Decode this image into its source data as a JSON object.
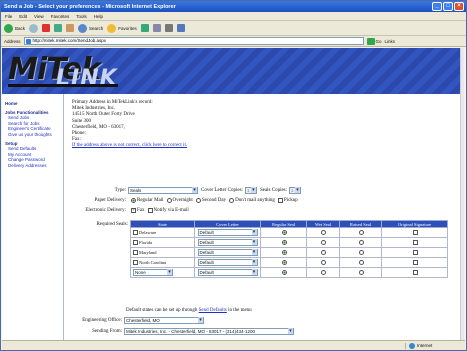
{
  "window": {
    "title": "Send a Job - Select your preferences - Microsoft Internet Explorer"
  },
  "menu": [
    "File",
    "Edit",
    "View",
    "Favorites",
    "Tools",
    "Help"
  ],
  "toolbar": {
    "back": "Back",
    "search": "Search",
    "favorites": "Favorites"
  },
  "address": {
    "label": "Address",
    "url": "http://mitek.mitek.com/SendJob.aspx",
    "go": "Go",
    "links": "Links"
  },
  "logo": {
    "part1": "MiTek",
    "part2": "LINK"
  },
  "sidebar": {
    "home": "Home",
    "job_section": "Jobs Functionalities",
    "job_links": [
      "Send Jobs",
      "Search for Jobs",
      "Engineer's Certificate",
      "Give us your thoughts"
    ],
    "setup_section": "Setup",
    "setup_links": [
      "Send Defaults",
      "My Account",
      "Change Password",
      "Delivery Addresses"
    ]
  },
  "address_block": {
    "heading": "Primary Address in MiTekLink's record:",
    "company": "Mitek Industries, Inc.",
    "street": "14515 North Outer Forty Drive",
    "suite": "Suite 300",
    "city": "Chesterfield, MO - 63017,",
    "phone": "Phone:",
    "fax": "Fax:",
    "correct_link": "If the address above is not correct, click here to correct it."
  },
  "form": {
    "type_label": "Type:",
    "type_value": "Seals",
    "cover_copies_label": "Cover Letter Copies:",
    "cover_copies_value": "1",
    "seal_copies_label": "Seals Copies:",
    "seal_copies_value": "1",
    "paper_label": "Paper Delivery:",
    "paper_options": [
      "Regular Mail",
      "Overnight",
      "Second Day",
      "Don't mail anything",
      "Pickup"
    ],
    "electronic_label": "Electronic Delivery:",
    "electronic_options": [
      "Fax",
      "Notify via E-mail"
    ],
    "required_label": "Required Seals:"
  },
  "seals_table": {
    "headers": [
      "State",
      "Cover Letter",
      "Regular Seal",
      "Wet Seal",
      "Raised Seal",
      "Original Signature"
    ],
    "rows": [
      {
        "state": "Delaware",
        "cover": "Default"
      },
      {
        "state": "Florida",
        "cover": "Default"
      },
      {
        "state": "Maryland",
        "cover": "Default"
      },
      {
        "state": "North Carolina",
        "cover": "Default"
      },
      {
        "state": "None",
        "cover": "Default"
      }
    ]
  },
  "footer": {
    "defaults_note": "Default states can be set up through",
    "defaults_link": "Send Defaults",
    "defaults_tail": "in the menu",
    "engineering_label": "Engineering Office:",
    "engineering_value": "Chesterfield, MO",
    "sending_label": "Sending From:",
    "sending_value": "Mitek Industries, Inc. - Chesterfield, MO - 63017 - (314)434-1200"
  },
  "status": {
    "left": "",
    "zone": "Internet"
  },
  "colors": {
    "banner": "#2f4fb8",
    "titlebar": "#1c4fc0",
    "link": "#2030c0"
  }
}
